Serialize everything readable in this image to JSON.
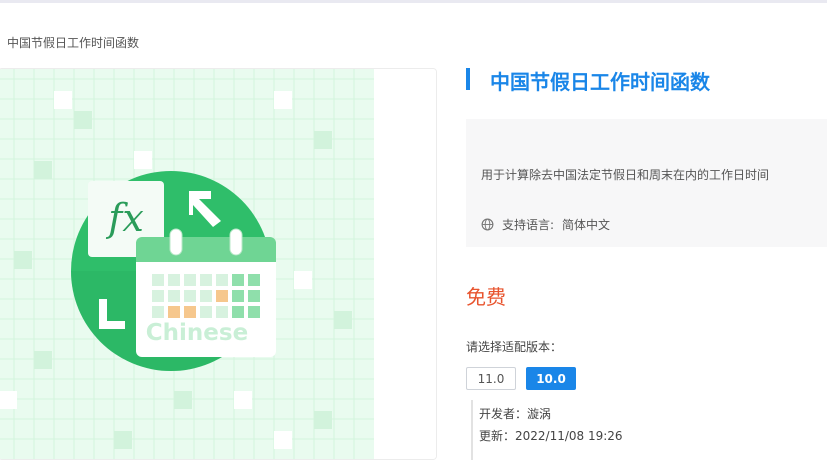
{
  "breadcrumb": "中国节假日工作时间函数",
  "product": {
    "title": "中国节假日工作时间函数",
    "description": "用于计算除去中国法定节假日和周末在内的工作日时间",
    "language_label": "支持语言:",
    "language_value": "简体中文",
    "price": "免费"
  },
  "illustration": {
    "fx_text": "fx",
    "watermark_text": "Chinese"
  },
  "versions": {
    "label": "请选择适配版本：",
    "options": [
      "11.0",
      "10.0"
    ],
    "selected": "10.0"
  },
  "meta": {
    "developer": "开发者：漩涡",
    "updated": "更新：2022/11/08 19:26"
  },
  "colors": {
    "accent": "#1a86e8",
    "price": "#e8542e",
    "green": "#2fbe6a"
  },
  "icons": {
    "language": "globe-icon"
  }
}
